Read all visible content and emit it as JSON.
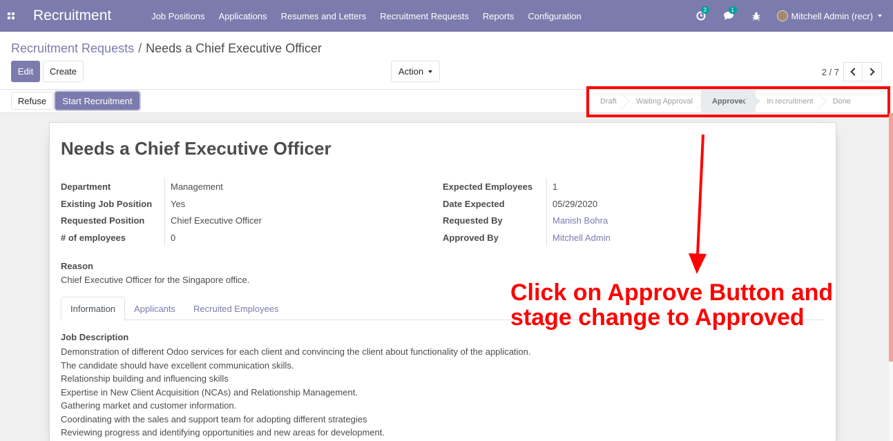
{
  "navbar": {
    "brand": "Recruitment",
    "menu": [
      "Job Positions",
      "Applications",
      "Resumes and Letters",
      "Recruitment Requests",
      "Reports",
      "Configuration"
    ],
    "activity_badge": "3",
    "messages_badge": "1",
    "user": "Mitchell Admin (recr)"
  },
  "breadcrumb": {
    "parent": "Recruitment Requests",
    "separator": "/",
    "current": "Needs a Chief Executive Officer"
  },
  "buttons": {
    "edit": "Edit",
    "create": "Create",
    "action": "Action",
    "refuse": "Refuse",
    "start_recruitment": "Start Recruitment"
  },
  "pager": {
    "value": "2 / 7"
  },
  "stages": [
    "Draft",
    "Waiting Approval",
    "Approved",
    "In recruitment",
    "Done"
  ],
  "active_stage": "Approved",
  "form": {
    "title": "Needs a Chief Executive Officer",
    "left_fields": [
      {
        "label": "Department",
        "value": "Management"
      },
      {
        "label": "Existing Job Position",
        "value": "Yes"
      },
      {
        "label": "Requested Position",
        "value": "Chief Executive Officer"
      },
      {
        "label": "# of employees",
        "value": "0"
      }
    ],
    "right_fields": [
      {
        "label": "Expected Employees",
        "value": "1"
      },
      {
        "label": "Date Expected",
        "value": "05/29/2020"
      },
      {
        "label": "Requested By",
        "value": "Manish Bohra"
      },
      {
        "label": "Approved By",
        "value": "Mitchell Admin"
      }
    ],
    "reason_label": "Reason",
    "reason": "Chief Executive Officer for the Singapore office.",
    "tabs": [
      "Information",
      "Applicants",
      "Recruited Employees"
    ],
    "job_description_label": "Job Description",
    "job_description": [
      "Demonstration of different Odoo services for each client and convincing the client about functionality of the application.",
      "The candidate should have excellent communication skills.",
      "Relationship building and influencing skills",
      "Expertise in New Client Acquisition (NCAs) and Relationship Management.",
      "Gathering market and customer information.",
      "Coordinating with the sales and support team for adopting different strategies",
      "Reviewing progress and identifying opportunities and new areas for development."
    ]
  },
  "annotation": {
    "line1": "Click on Approve Button and",
    "line2": "stage change to Approved"
  },
  "colors": {
    "brand": "#7c7bad",
    "annotation": "#ff0000",
    "badge": "#00a09d"
  }
}
